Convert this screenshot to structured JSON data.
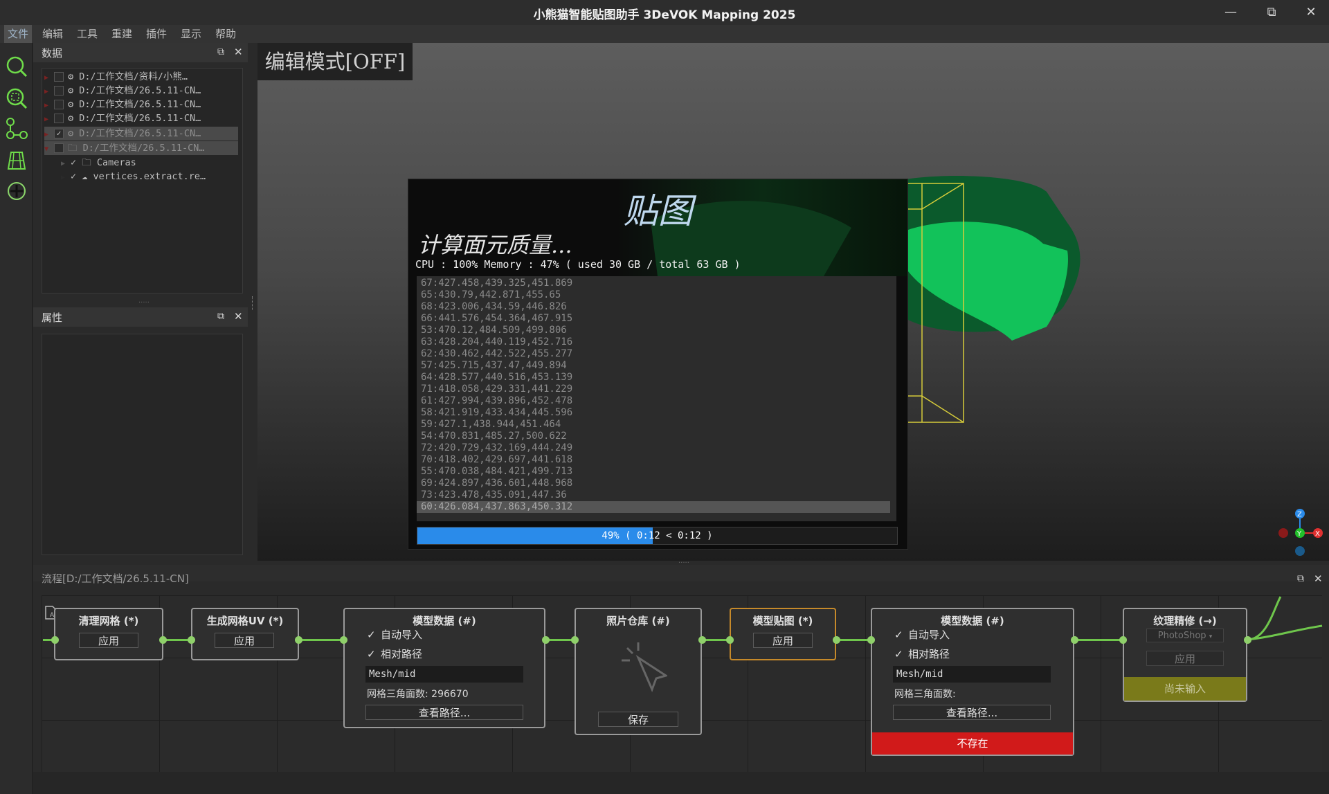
{
  "window": {
    "title": "小熊猫智能贴图助手 3DeVOK Mapping 2025",
    "minimize": "—",
    "restore": "⧉",
    "close": "✕"
  },
  "menu": [
    "文件",
    "编辑",
    "工具",
    "重建",
    "插件",
    "显示",
    "帮助"
  ],
  "data_panel": {
    "title": "数据",
    "items": [
      {
        "label": "D:/工作文档/资料/小熊…",
        "checked": false,
        "selected": false
      },
      {
        "label": "D:/工作文档/26.5.11-CN…",
        "checked": false,
        "selected": false
      },
      {
        "label": "D:/工作文档/26.5.11-CN…",
        "checked": false,
        "selected": false
      },
      {
        "label": "D:/工作文档/26.5.11-CN…",
        "checked": false,
        "selected": false
      },
      {
        "label": "D:/工作文档/26.5.11-CN…",
        "checked": true,
        "selected": true
      },
      {
        "label": "D:/工作文档/26.5.11-CN…",
        "checked": false,
        "selected": true
      }
    ],
    "children": [
      {
        "label": "Cameras"
      },
      {
        "label": "vertices.extract.re…"
      }
    ]
  },
  "properties_panel": {
    "title": "属性"
  },
  "viewport": {
    "edit_mode": "编辑模式[OFF]"
  },
  "progress_dialog": {
    "title": "贴图",
    "task": "计算面元质量...",
    "status": "CPU : 100%  Memory : 47% ( used 30 GB / total 63 GB )",
    "log": [
      "67:427.458,439.325,451.869",
      "65:430.79,442.871,455.65",
      "68:423.006,434.59,446.826",
      "66:441.576,454.364,467.915",
      "53:470.12,484.509,499.806",
      "63:428.204,440.119,452.716",
      "62:430.462,442.522,455.277",
      "57:425.715,437.47,449.894",
      "64:428.577,440.516,453.139",
      "71:418.058,429.331,441.229",
      "61:427.994,439.896,452.478",
      "58:421.919,433.434,445.596",
      "59:427.1,438.944,451.464",
      "54:470.831,485.27,500.622",
      "72:420.729,432.169,444.249",
      "70:418.402,429.697,441.618",
      "55:470.038,484.421,499.713",
      "69:424.897,436.601,448.968",
      "73:423.478,435.091,447.36",
      "60:426.084,437.863,450.312"
    ],
    "progress_percent": 49,
    "progress_text": "49% ( 0:12 < 0:12 )"
  },
  "flow_panel": {
    "title": "流程[D:/工作文档/26.5.11-CN]",
    "nodes": {
      "clean_mesh": {
        "title": "清理网格 (*)",
        "button": "应用"
      },
      "gen_uv": {
        "title": "生成网格UV (*)",
        "button": "应用"
      },
      "model_data_1": {
        "title": "模型数据 (#)",
        "auto_import": "自动导入",
        "relative_path": "相对路径",
        "path": "Mesh/mid",
        "tri_count": "网格三角面数: 296670",
        "view_path": "查看路径..."
      },
      "photo_repo": {
        "title": "照片仓库 (#)",
        "button": "保存"
      },
      "model_texture": {
        "title": "模型贴图 (*)",
        "button": "应用"
      },
      "model_data_2": {
        "title": "模型数据 (#)",
        "auto_import": "自动导入",
        "relative_path": "相对路径",
        "path": "Mesh/mid",
        "tri_count": "网格三角面数:",
        "view_path": "查看路径...",
        "status": "不存在"
      },
      "texture_refine": {
        "title": "纹理精修 (→)",
        "dropdown": "PhotoShop",
        "button": "应用",
        "status": "尚未输入"
      }
    }
  },
  "colors": {
    "accent_blue": "#2a8bea",
    "wire_green": "#6fc64c",
    "error_red": "#d11a1a",
    "pending_olive": "#7a7a1a",
    "model_green": "#0fc85a"
  }
}
